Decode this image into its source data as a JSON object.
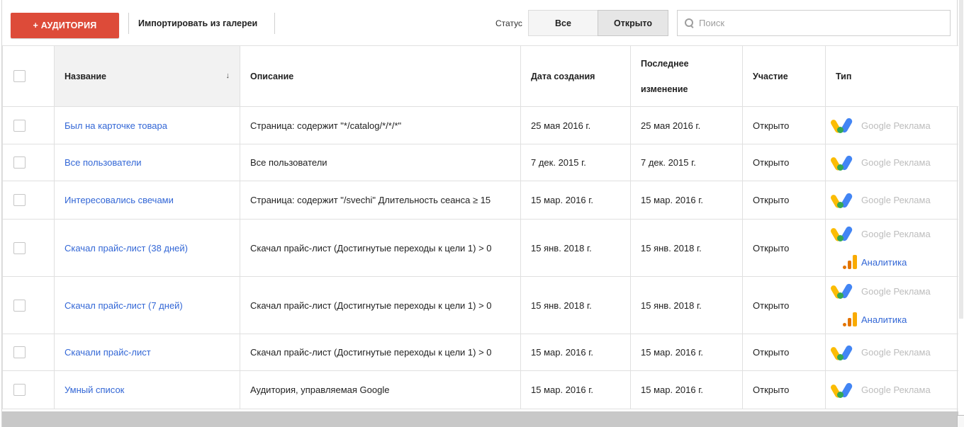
{
  "toolbar": {
    "add_label": "+ АУДИТОРИЯ",
    "import_label": "Импортировать из галереи",
    "status_label": "Статус",
    "seg_all": "Все",
    "seg_open": "Открыто",
    "search_placeholder": "Поиск"
  },
  "table": {
    "headers": {
      "name": "Название",
      "sort_arrow": "↓",
      "description": "Описание",
      "created": "Дата создания",
      "modified_1": "Последнее",
      "modified_2": "изменение",
      "participation": "Участие",
      "type": "Тип"
    },
    "type_labels": {
      "ads": "Google Реклама",
      "analytics": "Аналитика"
    },
    "rows": [
      {
        "name": "Был на карточке товара",
        "description": "Страница: содержит \"*/catalog/*/*/*\"",
        "created": "25 мая 2016 г.",
        "modified": "25 мая 2016 г.",
        "participation": "Открыто"
      },
      {
        "name": "Все пользователи",
        "description": "Все пользователи",
        "created": "7 дек. 2015 г.",
        "modified": "7 дек. 2015 г.",
        "participation": "Открыто"
      },
      {
        "name": "Интересовались свечами",
        "description": "Страница: содержит \"/svechi\" Длительность сеанса ≥ 15",
        "created": "15 мар. 2016 г.",
        "modified": "15 мар. 2016 г.",
        "participation": "Открыто"
      },
      {
        "name": "Скачал прайс-лист (38 дней)",
        "description": "Скачал прайс-лист (Достигнутые переходы к цели 1) > 0",
        "created": "15 янв. 2018 г.",
        "modified": "15 янв. 2018 г.",
        "participation": "Открыто"
      },
      {
        "name": "Скачал прайс-лист (7 дней)",
        "description": "Скачал прайс-лист (Достигнутые переходы к цели 1) > 0",
        "created": "15 янв. 2018 г.",
        "modified": "15 янв. 2018 г.",
        "participation": "Открыто"
      },
      {
        "name": "Скачали прайс-лист",
        "description": "Скачал прайс-лист (Достигнутые переходы к цели 1) > 0",
        "created": "15 мар. 2016 г.",
        "modified": "15 мар. 2016 г.",
        "participation": "Открыто"
      },
      {
        "name": "Умный список",
        "description": "Аудитория, управляемая Google",
        "created": "15 мар. 2016 г.",
        "modified": "15 мар. 2016 г.",
        "participation": "Открыто"
      }
    ]
  }
}
